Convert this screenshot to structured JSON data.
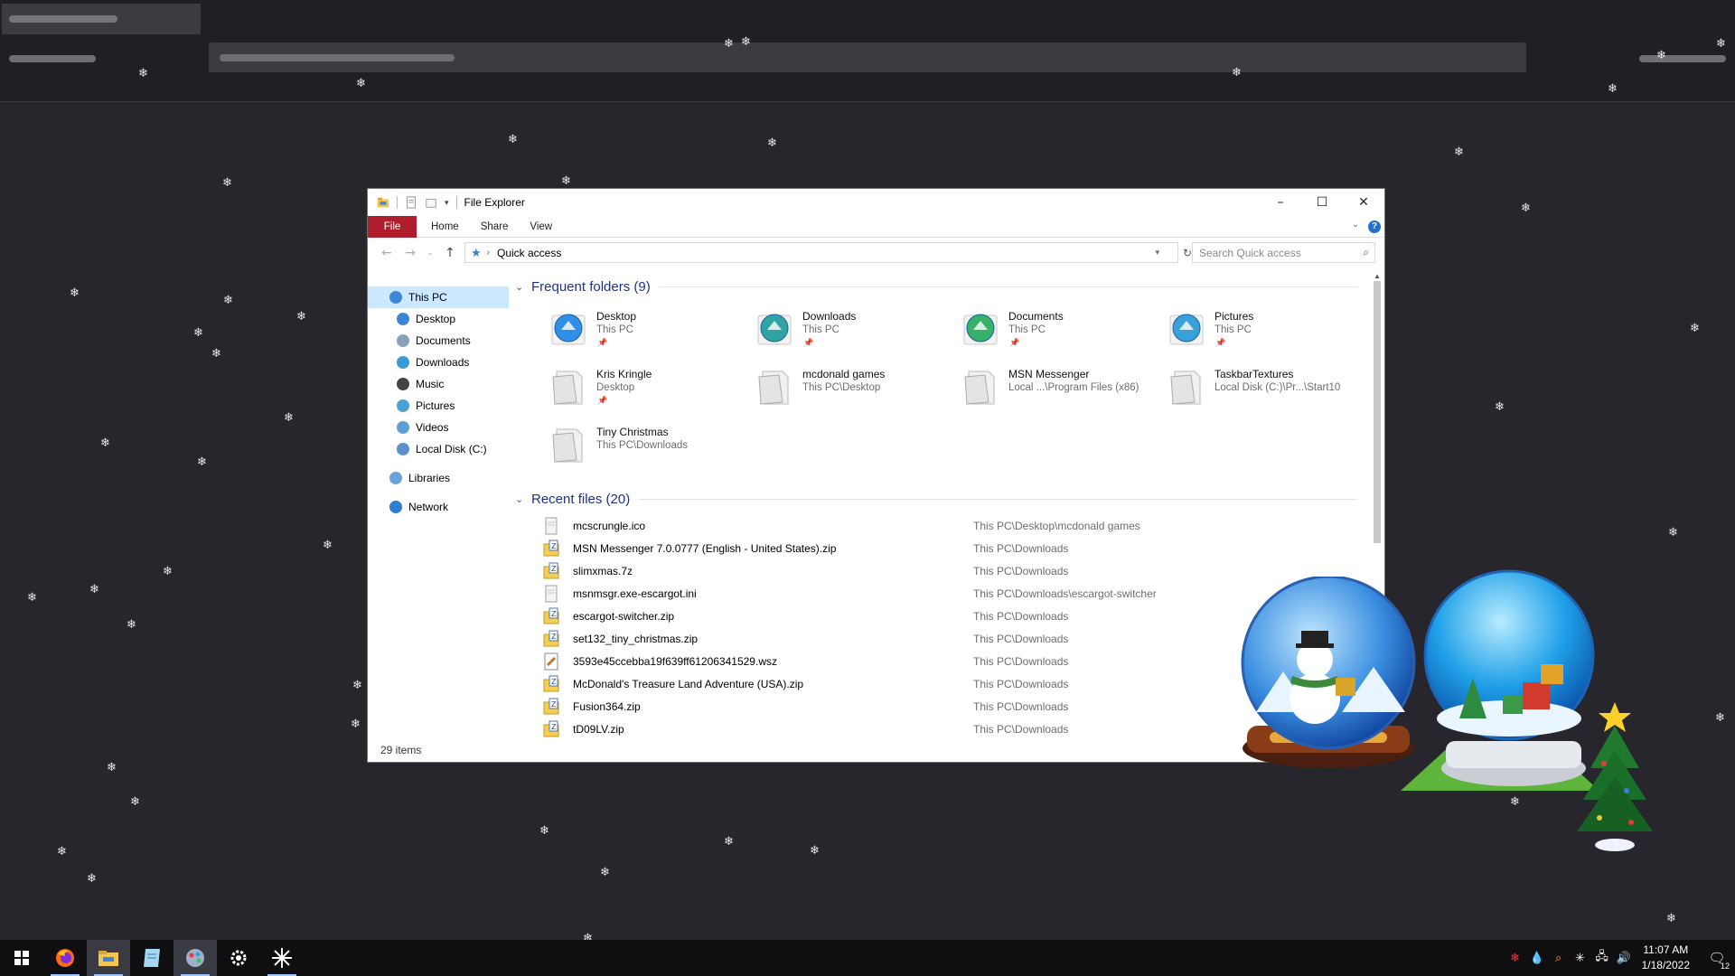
{
  "window": {
    "title": "File Explorer",
    "ribbon_tabs": [
      "File",
      "Home",
      "Share",
      "View"
    ],
    "address": "Quick access",
    "search_placeholder": "Search Quick access",
    "status": "29 items"
  },
  "nav": {
    "items": [
      {
        "label": "This PC",
        "color": "#3d86d6"
      },
      {
        "label": "Desktop",
        "color": "#3d86d6"
      },
      {
        "label": "Documents",
        "color": "#8aa0b8"
      },
      {
        "label": "Downloads",
        "color": "#3a9ad9"
      },
      {
        "label": "Music",
        "color": "#444444"
      },
      {
        "label": "Pictures",
        "color": "#4aa3d8"
      },
      {
        "label": "Videos",
        "color": "#5aa0d6"
      },
      {
        "label": "Local Disk (C:)",
        "color": "#5c8fd0"
      },
      {
        "label": "Libraries",
        "color": "#6aa2d8"
      },
      {
        "label": "Network",
        "color": "#2d7ed0"
      }
    ]
  },
  "frequent": {
    "heading": "Frequent folders (9)",
    "folders": [
      {
        "name": "Desktop",
        "location": "This PC",
        "pinned": true,
        "icon": "desktop-folder-icon"
      },
      {
        "name": "Downloads",
        "location": "This PC",
        "pinned": true,
        "icon": "downloads-folder-icon"
      },
      {
        "name": "Documents",
        "location": "This PC",
        "pinned": true,
        "icon": "documents-folder-icon"
      },
      {
        "name": "Pictures",
        "location": "This PC",
        "pinned": true,
        "icon": "pictures-folder-icon"
      },
      {
        "name": "Kris Kringle",
        "location": "Desktop",
        "pinned": true,
        "icon": "folder-icon"
      },
      {
        "name": "mcdonald games",
        "location": "This PC\\Desktop",
        "pinned": false,
        "icon": "folder-icon"
      },
      {
        "name": "MSN Messenger",
        "location": "Local ...\\Program Files (x86)",
        "pinned": false,
        "icon": "folder-icon"
      },
      {
        "name": "TaskbarTextures",
        "location": "Local Disk (C:)\\Pr...\\Start10",
        "pinned": false,
        "icon": "folder-icon"
      },
      {
        "name": "Tiny Christmas",
        "location": "This PC\\Downloads",
        "pinned": false,
        "icon": "folder-icon"
      }
    ],
    "pin_glyph": "📌"
  },
  "recent": {
    "heading": "Recent files (20)",
    "files": [
      {
        "name": "mcscrungle.ico",
        "location": "This PC\\Desktop\\mcdonald games",
        "icon": "ico-file-icon"
      },
      {
        "name": "MSN Messenger 7.0.0777 (English - United States).zip",
        "location": "This PC\\Downloads",
        "icon": "zip-file-icon"
      },
      {
        "name": "slimxmas.7z",
        "location": "This PC\\Downloads",
        "icon": "zip-file-icon"
      },
      {
        "name": "msnmsgr.exe-escargot.ini",
        "location": "This PC\\Downloads\\escargot-switcher",
        "icon": "ini-file-icon"
      },
      {
        "name": "escargot-switcher.zip",
        "location": "This PC\\Downloads",
        "icon": "zip-file-icon"
      },
      {
        "name": "set132_tiny_christmas.zip",
        "location": "This PC\\Downloads",
        "icon": "zip-file-icon"
      },
      {
        "name": "3593e45ccebba19f639ff61206341529.wsz",
        "location": "This PC\\Downloads",
        "icon": "wsz-file-icon"
      },
      {
        "name": "McDonald's Treasure Land Adventure (USA).zip",
        "location": "This PC\\Downloads",
        "icon": "zip-file-icon"
      },
      {
        "name": "Fusion364.zip",
        "location": "This PC\\Downloads",
        "icon": "zip-file-icon"
      },
      {
        "name": "tD09LV.zip",
        "location": "This PC\\Downloads",
        "icon": "zip-file-icon"
      }
    ]
  },
  "taskbar": {
    "apps": [
      "start-icon",
      "firefox-icon",
      "file-explorer-icon",
      "notepad-icon",
      "paint-icon",
      "settings-icon",
      "snowflake-app-icon"
    ],
    "time": "11:07 AM",
    "date": "1/18/2022",
    "notification_count": "12"
  },
  "colors": {
    "accent_file_tab": "#b01e2d",
    "link_heading": "#1e3287",
    "selection": "#cce8ff"
  }
}
